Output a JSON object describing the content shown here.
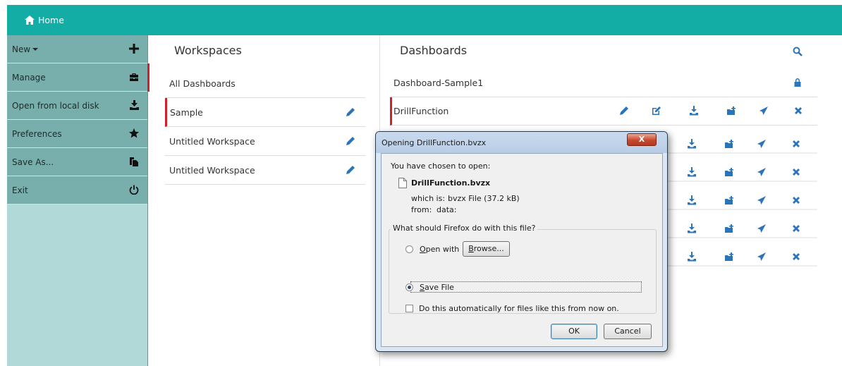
{
  "topbar": {
    "home_label": "Home",
    "home_icon": "home-icon"
  },
  "sidebar": {
    "items": [
      {
        "label": "New",
        "icon": "plus-icon"
      },
      {
        "label": "Manage",
        "icon": "briefcase-icon"
      },
      {
        "label": "Open from local disk",
        "icon": "upload-icon"
      },
      {
        "label": "Preferences",
        "icon": "star-icon"
      },
      {
        "label": "Save As...",
        "icon": "copy-icon"
      },
      {
        "label": "Exit",
        "icon": "power-icon"
      }
    ]
  },
  "workspaces": {
    "title": "Workspaces",
    "items": [
      "All Dashboards",
      "Sample",
      "Untitled Workspace",
      "Untitled Workspace"
    ]
  },
  "dashboards": {
    "title": "Dashboards",
    "rows": [
      "Dashboard-Sample1",
      "DrillFunction"
    ]
  },
  "dialog": {
    "title": "Opening DrillFunction.bvzx",
    "close_label": "X",
    "intro": "You have chosen to open:",
    "filename": "DrillFunction.bvzx",
    "which_is_label": "which is:",
    "which_is_value": "bvzx File (37.2 kB)",
    "from_label": "from:",
    "from_value": "data:",
    "question": "What should Firefox do with this file?",
    "open_with_label": "Open with",
    "browse_label": "Browse...",
    "save_file_label": "Save File",
    "auto_label": "Do this automatically for files like this from now on.",
    "ok_label": "OK",
    "cancel_label": "Cancel",
    "selected_option": "Save File"
  },
  "colors": {
    "accent": "#13ada6",
    "sidebar": "#78aeab",
    "active_marker": "#d0202a",
    "icon_blue": "#2b74b8"
  }
}
